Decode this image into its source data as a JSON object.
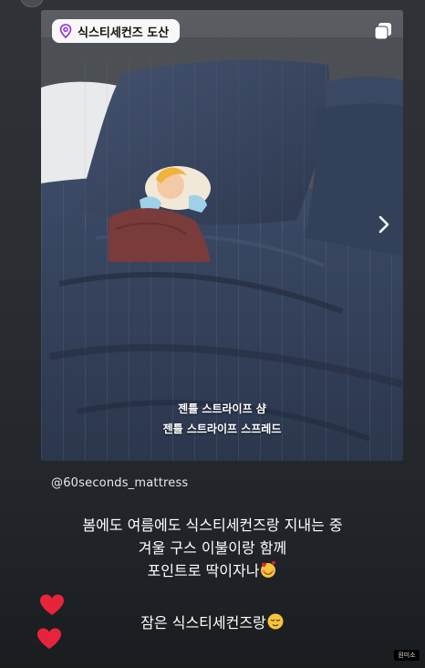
{
  "post": {
    "location": "식스티세컨즈 도산",
    "caption_line1": "젠틀 스트라이프 샴",
    "caption_line2": "젠틀 스트라이프 스프레드",
    "mention": "@60seconds_mattress",
    "text_line1": "봄에도 여름에도 식스티세컨즈랑 지내는 중",
    "text_line2": "겨울 구스 이불이랑 함께",
    "text_line3": "포인트로 딱이자나",
    "text_line4": "잠은 식스티세컨즈랑",
    "watermark": "원미소"
  },
  "icons": {
    "location": "location-pin-icon",
    "multi": "multiple-photos-icon",
    "next": "chevron-right-icon",
    "heart": "heart-icon",
    "emoji_love": "smiling-face-with-hearts-emoji",
    "emoji_sleep": "relieved-face-emoji"
  },
  "colors": {
    "heart": "#e8243c",
    "background": "#2a2e32"
  }
}
